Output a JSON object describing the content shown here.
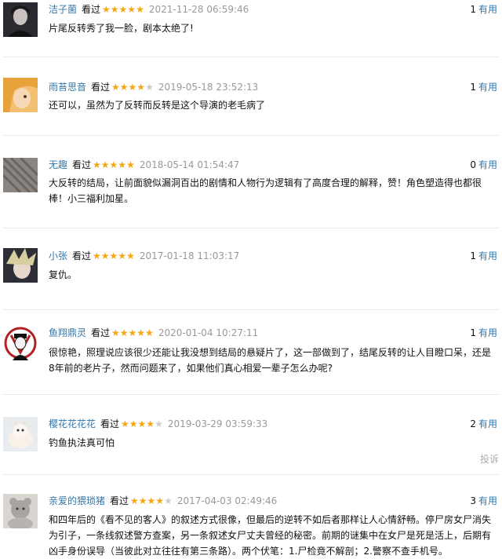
{
  "comments": [
    {
      "user": "洁子菌",
      "status": "看过",
      "rating": 5,
      "stars_text": "★★★★★",
      "time": "2021-11-28 06:59:46",
      "votes": "1",
      "useful_label": "有用",
      "content": "片尾反转秀了我一脸，剧本太绝了!"
    },
    {
      "user": "雨苔思音",
      "status": "看过",
      "rating": 4,
      "stars_text": "★★★★",
      "stars_off": "★",
      "time": "2019-05-18 23:52:13",
      "votes": "1",
      "useful_label": "有用",
      "content": "还可以，虽然为了反转而反转是这个导演的老毛病了"
    },
    {
      "user": "无趣",
      "status": "看过",
      "rating": 5,
      "stars_text": "★★★★★",
      "time": "2018-05-14 01:54:47",
      "votes": "0",
      "useful_label": "有用",
      "content_lines": [
        "大反转的结局，让前面貌似漏洞百出的剧情和人物行为逻辑有了高度合理的解释，赞！角色塑造得也都很",
        "棒！小三福利加星。"
      ]
    },
    {
      "user": "小张",
      "status": "看过",
      "rating": 5,
      "stars_text": "★★★★★",
      "time": "2017-01-18 11:03:17",
      "votes": "1",
      "useful_label": "有用",
      "content": "复仇。"
    },
    {
      "user": "鱼翔鼎灵",
      "status": "看过",
      "rating": 5,
      "stars_text": "★★★★★",
      "time": "2020-01-04 10:27:11",
      "votes": "1",
      "useful_label": "有用",
      "content_lines": [
        "很惊艳，照理说应该很少还能让我没想到结局的悬疑片了，这一部做到了，结尾反转的让人目瞪口呆，还是",
        "8年前的老片子，然而问题来了，如果他们真心相爱一辈子怎么办呢?"
      ]
    },
    {
      "user": "樱花花花花",
      "status": "看过",
      "rating": 4,
      "stars_text": "★★★★",
      "stars_off": "★",
      "time": "2019-03-29 03:59:33",
      "votes": "2",
      "useful_label": "有用",
      "content": "钓鱼执法真可怕",
      "report_label": "投诉"
    },
    {
      "user": "亲爱的猥琐猪",
      "status": "看过",
      "rating": 4,
      "stars_text": "★★★★",
      "stars_off": "★",
      "time": "2017-04-03 02:49:46",
      "votes": "3",
      "useful_label": "有用",
      "content_lines": [
        "和四年后的《看不见的客人》的叙述方式很像，但最后的逆转不如后者那样让人心情舒畅。停尸房女尸消失",
        "为引子，一条线叙述警方查案，另一条叙述女尸丈夫曾经的秘密。前期的谜集中在女尸是死是活上，后期有",
        "凶手身份误导（当彼此对立往往有第三条路）。两个伏笔：1.尸检竟不解剖；2.警察不查手机号。"
      ]
    }
  ]
}
